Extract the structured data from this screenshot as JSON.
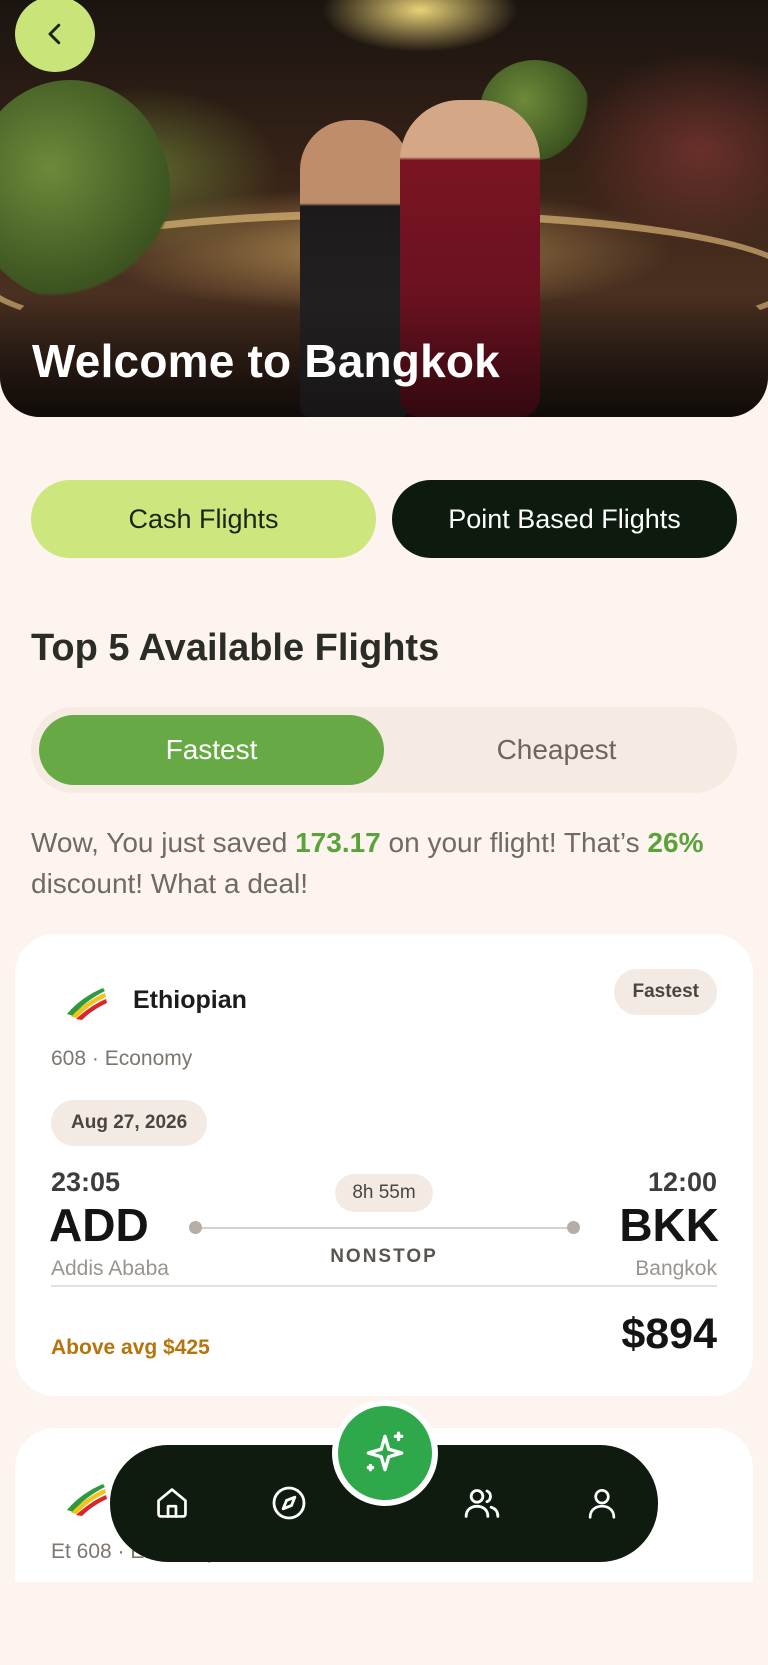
{
  "hero": {
    "title": "Welcome to Bangkok",
    "back_icon": "chevron-left-icon"
  },
  "flight_type_tabs": {
    "cash_label": "Cash Flights",
    "points_label": "Point Based Flights",
    "selected": "Cash Flights"
  },
  "section": {
    "title": "Top 5 Available Flights"
  },
  "sort_tabs": {
    "fastest_label": "Fastest",
    "cheapest_label": "Cheapest",
    "selected": "Fastest"
  },
  "savings": {
    "prefix": "Wow, You just saved ",
    "amount": "173.17",
    "middle": " on your flight! That’s ",
    "percent": "26%",
    "suffix": " discount! What a deal!"
  },
  "flights": [
    {
      "airline": "Ethiopian",
      "tag": "Fastest",
      "meta": "608 · Economy",
      "date": "Aug 27, 2026",
      "departure": {
        "time": "23:05",
        "code": "ADD",
        "city": "Addis Ababa"
      },
      "arrival": {
        "time": "12:00",
        "code": "BKK",
        "city": "Bangkok"
      },
      "duration": "8h 55m",
      "stops": "NONSTOP",
      "avg_note": "Above avg $425",
      "price": "$894"
    },
    {
      "meta": "Et 608 · Economy"
    }
  ],
  "nav": {
    "items": [
      "home-icon",
      "compass-icon",
      "sparkle-icon",
      "users-icon",
      "user-icon"
    ]
  },
  "colors": {
    "background": "#fdf3ef",
    "accent_lime": "#cde67d",
    "accent_green": "#67aa45",
    "dark": "#0e1b0e",
    "fab_green": "#2fa84b",
    "warning_amber": "#b8730b"
  }
}
